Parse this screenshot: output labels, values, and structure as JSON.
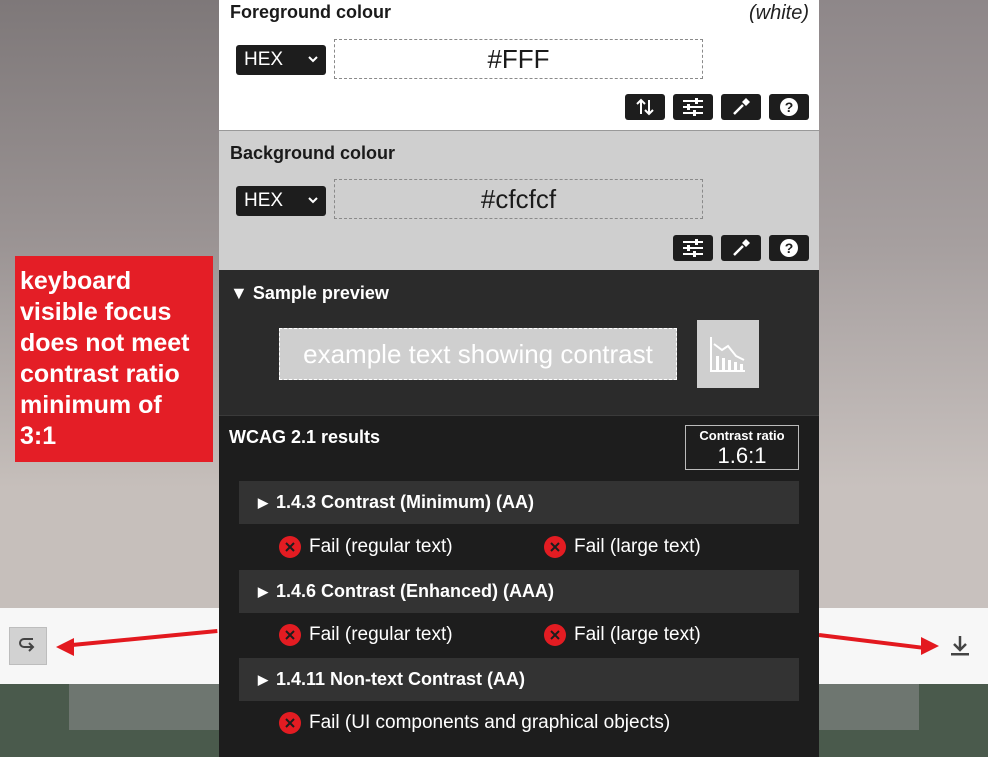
{
  "foreground": {
    "title": "Foreground colour",
    "color_name": "(white)",
    "format": "HEX",
    "value": "#FFF",
    "tools": [
      "swap-icon",
      "sliders-icon",
      "eyedropper-icon",
      "help-icon"
    ]
  },
  "background": {
    "title": "Background colour",
    "format": "HEX",
    "value": "#cfcfcf",
    "tools": [
      "sliders-icon",
      "eyedropper-icon",
      "help-icon"
    ]
  },
  "preview": {
    "title": "Sample preview",
    "sample_text": "example text showing contrast"
  },
  "results": {
    "title": "WCAG 2.1 results",
    "ratio_label": "Contrast ratio",
    "ratio_value": "1.6:1",
    "criteria": [
      {
        "label": "1.4.3 Contrast (Minimum) (AA)",
        "fails": [
          "Fail (regular text)",
          "Fail (large text)"
        ]
      },
      {
        "label": "1.4.6 Contrast (Enhanced) (AAA)",
        "fails": [
          "Fail (regular text)",
          "Fail (large text)"
        ]
      },
      {
        "label": "1.4.11 Non-text Contrast (AA)",
        "fails": [
          "Fail (UI components and graphical objects)"
        ]
      }
    ]
  },
  "callout": {
    "text": " keyboard\nvisible focus\ndoes not meet\ncontrast ratio\nminimum of\n3:1"
  },
  "colors": {
    "callout_red": "#e41e26",
    "fail_red": "#e31c22",
    "panel_dark": "#1d1d1d",
    "background_sample": "#cfcfcf"
  }
}
